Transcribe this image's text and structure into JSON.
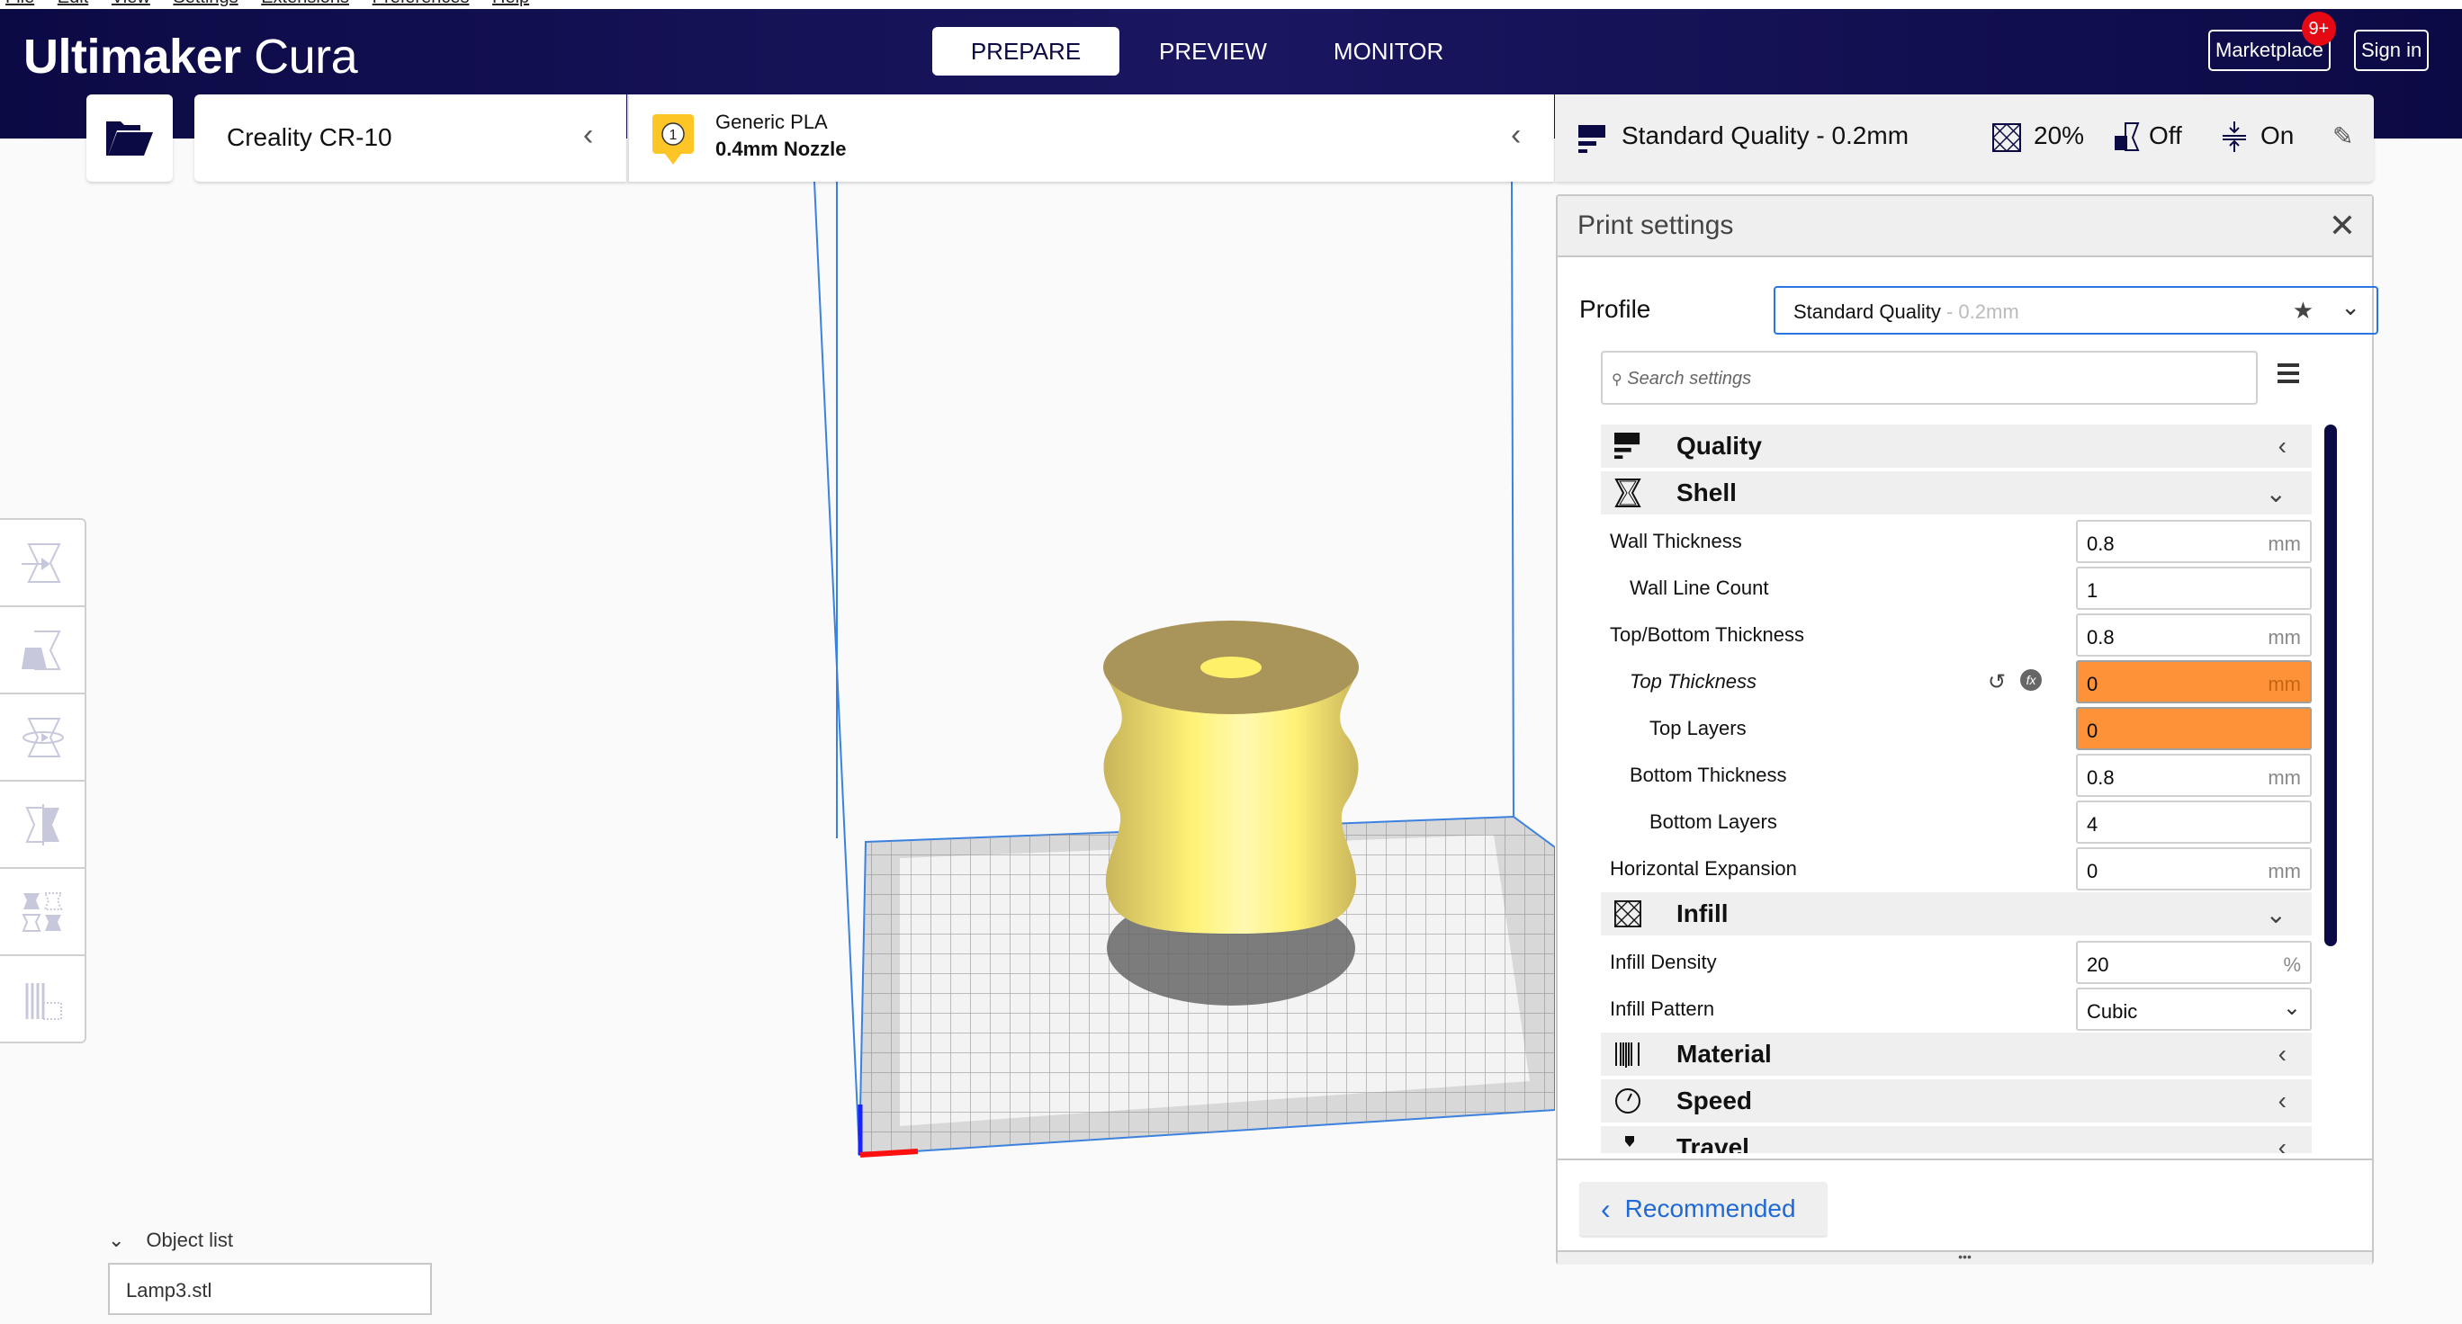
{
  "menubar": [
    "File",
    "Edit",
    "View",
    "Settings",
    "Extensions",
    "Preferences",
    "Help"
  ],
  "header": {
    "logo_bold": "Ultimaker",
    "logo_light": "Cura",
    "tabs": [
      {
        "label": "PREPARE",
        "active": true
      },
      {
        "label": "PREVIEW",
        "active": false
      },
      {
        "label": "MONITOR",
        "active": false
      }
    ],
    "marketplace": "Marketplace",
    "marketplace_badge": "9+",
    "signin": "Sign in"
  },
  "selectors": {
    "printer": "Creality CR-10",
    "extruder_number": "1",
    "material": "Generic PLA",
    "nozzle": "0.4mm Nozzle",
    "quality": "Standard Quality - 0.2mm",
    "infill": "20%",
    "support": "Off",
    "adhesion": "On"
  },
  "print_settings": {
    "title": "Print settings",
    "profile_label": "Profile",
    "profile_name": "Standard Quality",
    "profile_suffix": " - 0.2mm",
    "search_placeholder": "Search settings",
    "categories": {
      "quality": "Quality",
      "shell": "Shell",
      "infill": "Infill",
      "material": "Material",
      "speed": "Speed",
      "travel": "Travel"
    },
    "shell_settings": [
      {
        "label": "Wall Thickness",
        "value": "0.8",
        "unit": "mm",
        "indent": 0
      },
      {
        "label": "Wall Line Count",
        "value": "1",
        "unit": "",
        "indent": 1
      },
      {
        "label": "Top/Bottom Thickness",
        "value": "0.8",
        "unit": "mm",
        "indent": 0
      },
      {
        "label": "Top Thickness",
        "value": "0",
        "unit": "mm",
        "indent": 1,
        "warning": true,
        "italic": true
      },
      {
        "label": "Top Layers",
        "value": "0",
        "unit": "",
        "indent": 2,
        "warning": true
      },
      {
        "label": "Bottom Thickness",
        "value": "0.8",
        "unit": "mm",
        "indent": 1
      },
      {
        "label": "Bottom Layers",
        "value": "4",
        "unit": "",
        "indent": 2
      },
      {
        "label": "Horizontal Expansion",
        "value": "0",
        "unit": "mm",
        "indent": 0
      }
    ],
    "infill_settings": [
      {
        "label": "Infill Density",
        "value": "20",
        "unit": "%"
      },
      {
        "label": "Infill Pattern",
        "value": "Cubic"
      }
    ],
    "recommended_button": "Recommended",
    "warning_color": "#fd9239",
    "accent_color": "#1f6ad6"
  },
  "object_list": {
    "title": "Object list",
    "items": [
      "Lamp3.stl"
    ]
  },
  "colors": {
    "header_bg": "#0c0a45",
    "model_yellow": "#ffef79",
    "plate_grey": "#e8e8e8"
  }
}
